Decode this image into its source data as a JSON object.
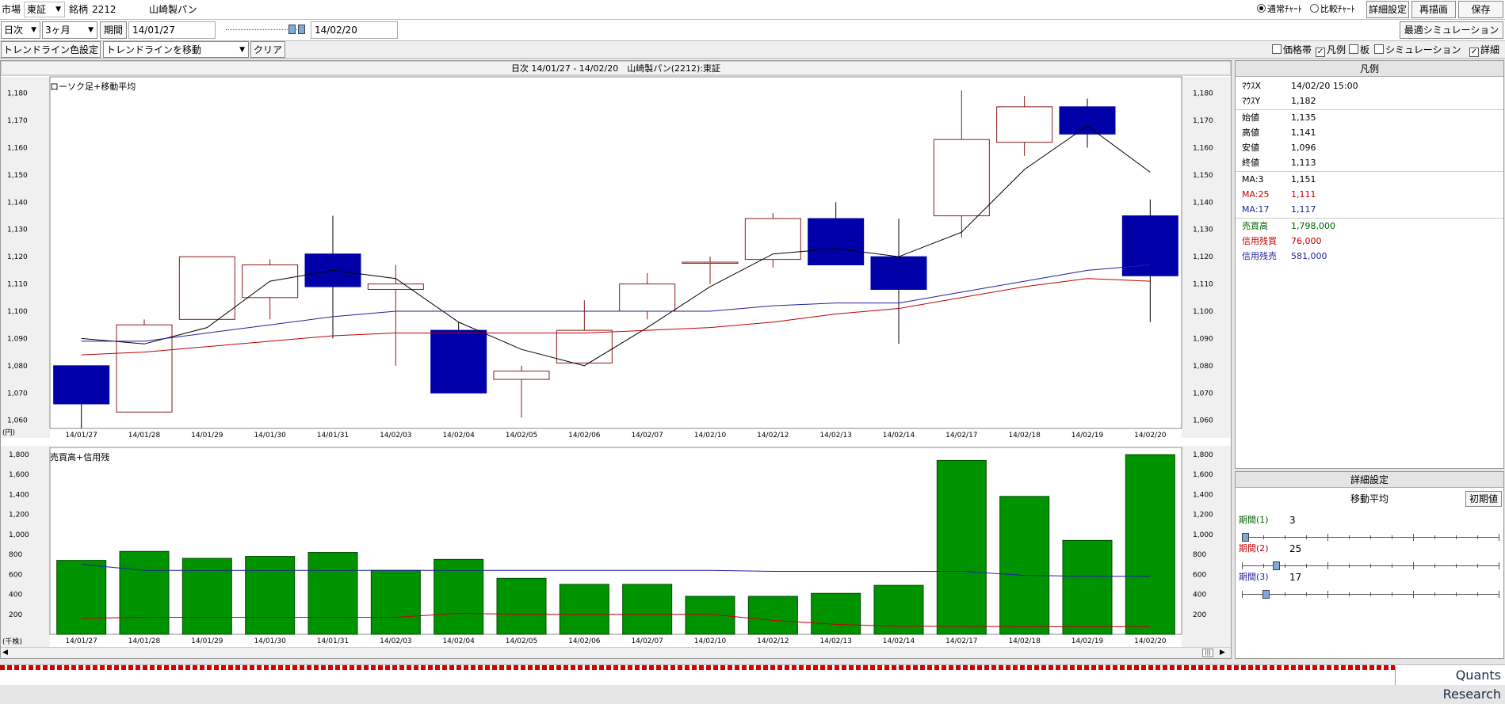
{
  "toolbar": {
    "market_label": "市場",
    "market_value": "東証",
    "code_label": "銘柄",
    "code_value": "2212",
    "company": "山崎製パン",
    "radio_normal": "通常ﾁｬｰﾄ",
    "radio_compare": "比較ﾁｬｰﾄ",
    "detail_button": "詳細設定",
    "redraw_button": "再描画",
    "save_button": "保存"
  },
  "period_bar": {
    "interval": "日次",
    "range": "3ヶ月",
    "period_label": "期間",
    "start_date": "14/01/27",
    "end_date": "14/02/20",
    "simulation_button": "最適シミュレーション"
  },
  "trend_bar": {
    "color_button": "トレンドライン色設定",
    "mode": "トレンドラインを移動",
    "clear_button": "クリア",
    "options": [
      {
        "label": "価格帯",
        "checked": false
      },
      {
        "label": "凡例",
        "checked": true
      },
      {
        "label": "板",
        "checked": false
      },
      {
        "label": "シミュレーション",
        "checked": false
      },
      {
        "label": "詳細",
        "checked": true
      }
    ]
  },
  "chart_header": "日次 14/01/27 - 14/02/20　山崎製パン(2212):東証",
  "chart_data": [
    {
      "type": "candlestick",
      "title": "ローソク足+移動平均",
      "unit_label": "(円)",
      "categories": [
        "14/01/27",
        "14/01/28",
        "14/01/29",
        "14/01/30",
        "14/01/31",
        "14/02/03",
        "14/02/04",
        "14/02/05",
        "14/02/06",
        "14/02/07",
        "14/02/10",
        "14/02/12",
        "14/02/13",
        "14/02/14",
        "14/02/17",
        "14/02/18",
        "14/02/19",
        "14/02/20"
      ],
      "open": [
        1080,
        1063,
        1097,
        1105,
        1121,
        1108,
        1093,
        1075,
        1081,
        1100,
        1118,
        1119,
        1134,
        1120,
        1135,
        1162,
        1175,
        1135
      ],
      "close": [
        1066,
        1095,
        1120,
        1117,
        1109,
        1110,
        1070,
        1078,
        1093,
        1110,
        1118,
        1134,
        1117,
        1108,
        1163,
        1175,
        1165,
        1113
      ],
      "high": [
        1080,
        1097,
        1120,
        1119,
        1135,
        1117,
        1096,
        1080,
        1104,
        1114,
        1120,
        1136,
        1140,
        1134,
        1181,
        1179,
        1178,
        1141
      ],
      "low": [
        1057,
        1063,
        1097,
        1097,
        1090,
        1080,
        1070,
        1061,
        1081,
        1097,
        1110,
        1116,
        1117,
        1088,
        1127,
        1157,
        1160,
        1096
      ],
      "ylim": [
        1057,
        1186
      ],
      "yticks": [
        1060,
        1070,
        1080,
        1090,
        1100,
        1110,
        1120,
        1130,
        1140,
        1150,
        1160,
        1170,
        1180
      ],
      "series": [
        {
          "name": "MA:3",
          "color": "#000000",
          "values": [
            1090,
            1088,
            1094,
            1111,
            1115,
            1112,
            1096,
            1086,
            1080,
            1094,
            1109,
            1121,
            1123,
            1120,
            1129,
            1152,
            1168,
            1151
          ]
        },
        {
          "name": "MA:25",
          "color": "#c00000",
          "values": [
            1084,
            1085,
            1087,
            1089,
            1091,
            1092,
            1092,
            1092,
            1092,
            1093,
            1094,
            1096,
            1099,
            1101,
            1105,
            1109,
            1112,
            1111
          ]
        },
        {
          "name": "MA:17",
          "color": "#1f1fa0",
          "values": [
            1089,
            1089,
            1092,
            1095,
            1098,
            1100,
            1100,
            1100,
            1100,
            1100,
            1100,
            1102,
            1103,
            1103,
            1107,
            1111,
            1115,
            1117
          ]
        }
      ]
    },
    {
      "type": "bar",
      "title": "売買高+信用残",
      "unit_label": "(千株)",
      "categories": [
        "14/01/27",
        "14/01/28",
        "14/01/29",
        "14/01/30",
        "14/01/31",
        "14/02/03",
        "14/02/04",
        "14/02/05",
        "14/02/06",
        "14/02/07",
        "14/02/10",
        "14/02/12",
        "14/02/13",
        "14/02/14",
        "14/02/17",
        "14/02/18",
        "14/02/19",
        "14/02/20"
      ],
      "values": [
        740,
        830,
        760,
        780,
        820,
        640,
        750,
        560,
        500,
        500,
        380,
        380,
        410,
        490,
        1740,
        1380,
        940,
        1798
      ],
      "ylim": [
        0,
        1870
      ],
      "yticks": [
        200,
        400,
        600,
        800,
        1000,
        1200,
        1400,
        1600,
        1800
      ],
      "bar_color": "#009300",
      "series": [
        {
          "name": "信用残売",
          "color": "#1f1fa0",
          "values": [
            700,
            640,
            640,
            640,
            640,
            640,
            640,
            640,
            640,
            640,
            640,
            630,
            630,
            630,
            630,
            590,
            580,
            581
          ]
        },
        {
          "name": "信用残買",
          "color": "#c00000",
          "values": [
            160,
            170,
            170,
            170,
            170,
            170,
            210,
            200,
            200,
            200,
            200,
            140,
            100,
            80,
            80,
            76,
            76,
            76
          ]
        }
      ]
    }
  ],
  "legend": {
    "title": "凡例",
    "mouse": [
      {
        "label": "ﾏｳｽX",
        "value": "14/02/20 15:00"
      },
      {
        "label": "ﾏｳｽY",
        "value": "1,182"
      }
    ],
    "ohlc": [
      {
        "label": "始値",
        "value": "1,135"
      },
      {
        "label": "高値",
        "value": "1,141"
      },
      {
        "label": "安値",
        "value": "1,096"
      },
      {
        "label": "終値",
        "value": "1,113"
      }
    ],
    "ma": [
      {
        "label": "MA:3",
        "value": "1,151",
        "color": "#000000"
      },
      {
        "label": "MA:25",
        "value": "1,111",
        "color": "#c00000"
      },
      {
        "label": "MA:17",
        "value": "1,117",
        "color": "#1f1fa0"
      }
    ],
    "volume": [
      {
        "label": "売買高",
        "value": "1,798,000",
        "color": "#006000"
      },
      {
        "label": "信用残買",
        "value": "76,000",
        "color": "#c00000"
      },
      {
        "label": "信用残売",
        "value": "581,000",
        "color": "#1f1fa0"
      }
    ]
  },
  "settings": {
    "title": "詳細設定",
    "section": "移動平均",
    "reset_button": "初期値",
    "periods": [
      {
        "label": "期間(1)",
        "value": "3",
        "position": 0.0
      },
      {
        "label": "期間(2)",
        "value": "25",
        "position": 0.12
      },
      {
        "label": "期間(3)",
        "value": "17",
        "position": 0.08
      }
    ]
  },
  "footer": {
    "brand": "Quants Research"
  }
}
